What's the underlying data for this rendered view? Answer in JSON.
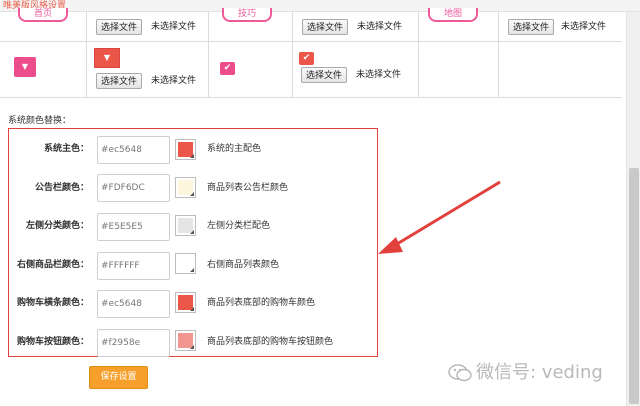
{
  "window": {
    "title": "唯美版风格设置"
  },
  "table": {
    "tags": [
      "首页",
      "技巧",
      "地图"
    ],
    "file_button_label": "选择文件",
    "no_file_text": "未选择文件",
    "dropdown_glyph": "▼",
    "check_glyph": "✔"
  },
  "colors_section": {
    "title": "系统颜色替换：",
    "rows": [
      {
        "label": "系统主色：",
        "value": "#ec5648",
        "swatch": "#ec5648",
        "desc": "系统的主配色"
      },
      {
        "label": "公告栏颜色：",
        "value": "#FDF6DC",
        "swatch": "#FDF6DC",
        "desc": "商品列表公告栏颜色"
      },
      {
        "label": "左侧分类颜色：",
        "value": "#E5E5E5",
        "swatch": "#E5E5E5",
        "desc": "左侧分类栏配色"
      },
      {
        "label": "右侧商品栏颜色：",
        "value": "#FFFFFF",
        "swatch": "#FFFFFF",
        "desc": "右侧商品列表颜色"
      },
      {
        "label": "购物车横条颜色：",
        "value": "#ec5648",
        "swatch": "#ec5648",
        "desc": "商品列表底部的购物车颜色"
      },
      {
        "label": "购物车按钮颜色：",
        "value": "#f2958e",
        "swatch": "#f2958e",
        "desc": "商品列表底部的购物车按钮颜色"
      }
    ]
  },
  "save_button": {
    "label": "保存设置"
  },
  "watermark": {
    "text": "微信号: veding"
  }
}
